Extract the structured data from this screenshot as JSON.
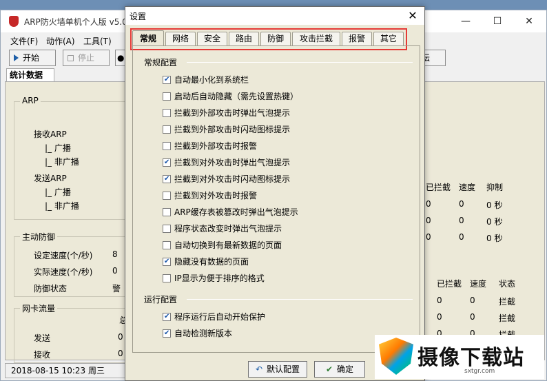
{
  "main_window": {
    "title": "ARP防火墙单机个人版 v5.0",
    "menu": [
      "文件(F)",
      "动作(A)",
      "工具(T)"
    ],
    "toolbar": {
      "start": "开始",
      "stop": "停止",
      "forum_partial": "坛"
    },
    "stats_tab": "统计数据",
    "arp": {
      "title": "ARP",
      "recv": "接收ARP",
      "send": "发送ARP",
      "broadcast": "|_ 广播",
      "non_broadcast": "|_ 非广播"
    },
    "defense": {
      "title": "主动防御",
      "set_speed": "设定速度(个/秒)",
      "set_speed_val": "8",
      "actual_speed": "实际速度(个/秒)",
      "actual_speed_val": "0",
      "status": "防御状态",
      "status_val": "警"
    },
    "nic": {
      "title": "网卡流量",
      "total_partial": "总",
      "send": "发送",
      "send_val": "0",
      "recv": "接收",
      "recv_val": "0"
    },
    "table1": {
      "headers": [
        "已拦截",
        "速度",
        "抑制"
      ],
      "rows": [
        [
          "0",
          "0",
          "0 秒"
        ],
        [
          "0",
          "0",
          "0 秒"
        ],
        [
          "0",
          "0",
          "0 秒"
        ]
      ]
    },
    "table2": {
      "headers": [
        "已拦截",
        "速度",
        "状态"
      ],
      "rows": [
        [
          "0",
          "0",
          "拦截"
        ],
        [
          "0",
          "0",
          "拦截"
        ],
        [
          "0",
          "0",
          "拦截"
        ]
      ]
    },
    "statusbar": "2018-08-15 10:23 周三"
  },
  "dialog": {
    "title": "设置",
    "tabs": [
      "常规",
      "网络",
      "安全",
      "路由",
      "防御",
      "攻击拦截",
      "报警",
      "其它"
    ],
    "section_general": "常规配置",
    "general_options": [
      {
        "label": "自动最小化到系统栏",
        "checked": true
      },
      {
        "label": "启动后自动隐藏（需先设置热键）",
        "checked": false
      },
      {
        "label": "拦截到外部攻击时弹出气泡提示",
        "checked": false
      },
      {
        "label": "拦截到外部攻击时闪动图标提示",
        "checked": false
      },
      {
        "label": "拦截到外部攻击时报警",
        "checked": false
      },
      {
        "label": "拦截到对外攻击时弹出气泡提示",
        "checked": true
      },
      {
        "label": "拦截到对外攻击时闪动图标提示",
        "checked": true
      },
      {
        "label": "拦截到对外攻击时报警",
        "checked": false
      },
      {
        "label": "ARP缓存表被篡改时弹出气泡提示",
        "checked": false
      },
      {
        "label": "程序状态改变时弹出气泡提示",
        "checked": false
      },
      {
        "label": "自动切换到有最新数据的页面",
        "checked": false
      },
      {
        "label": "隐藏没有数据的页面",
        "checked": true
      },
      {
        "label": "IP显示为便于排序的格式",
        "checked": false
      }
    ],
    "section_run": "运行配置",
    "run_options": [
      {
        "label": "程序运行后自动开始保护",
        "checked": true
      },
      {
        "label": "自动检测新版本",
        "checked": true
      }
    ],
    "buttons": {
      "default": "默认配置",
      "ok": "确定"
    }
  },
  "watermark": {
    "text": "摄像下载站",
    "sub": "sxtgr.com"
  }
}
